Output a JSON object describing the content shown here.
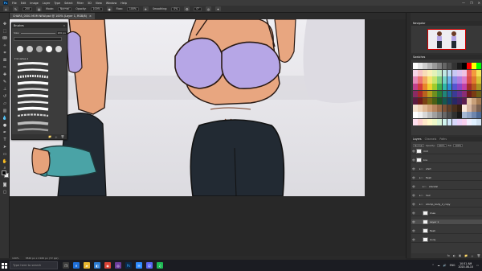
{
  "app": {
    "logo_label": "Ps",
    "menu": [
      "File",
      "Edit",
      "Image",
      "Layer",
      "Type",
      "Select",
      "Filter",
      "3D",
      "View",
      "Window",
      "Help"
    ],
    "window_controls": [
      "—",
      "❐",
      "✕"
    ]
  },
  "options_bar": {
    "size": "200",
    "mode_label": "Mode:",
    "mode_value": "Normal",
    "opacity_label": "Opacity:",
    "opacity_value": "100%",
    "flow_label": "Flow:",
    "flow_value": "100%",
    "smoothing_label": "Smoothing:",
    "smoothing_value": "0%",
    "angle_value": "0°"
  },
  "document_tab": {
    "title": "CHARS_0001 MOM NEW.psd @ 100% (Layer 1, RGB/8)",
    "close": "×"
  },
  "brushes_panel": {
    "title": "Brushes",
    "close": "«",
    "size_label": "Size:",
    "size_value": "200 px",
    "search_placeholder": "",
    "folder_name": "brushes 1"
  },
  "navigator_panel": {
    "tab": "Navigator"
  },
  "swatches_panel": {
    "tab": "Swatches",
    "colors": [
      "#ffffff",
      "#e8e8e8",
      "#cfcfcf",
      "#b5b5b5",
      "#9a9a9a",
      "#7f7f7f",
      "#666666",
      "#4d4d4d",
      "#333333",
      "#1a1a1a",
      "#000000",
      "#ff0000",
      "#ffff00",
      "#00ff00",
      "#f6d6e8",
      "#f7c3c3",
      "#f8dcb8",
      "#faf0b8",
      "#e3f2b8",
      "#c5ebc5",
      "#bfe8e3",
      "#bcdcf5",
      "#c8c8f3",
      "#dcc3f0",
      "#efc2e3",
      "#e55a5a",
      "#f39c3d",
      "#f2e35a",
      "#e38ab8",
      "#ea7070",
      "#f2a95e",
      "#f6e26e",
      "#c6e46a",
      "#7fd07f",
      "#6fd3c7",
      "#6ab4ea",
      "#8a8ae6",
      "#b07de0",
      "#dc7ac6",
      "#d94b4b",
      "#e07a2e",
      "#d6c236",
      "#c0418c",
      "#d33a3a",
      "#e8852b",
      "#efd02e",
      "#9fcb2c",
      "#3fb04f",
      "#2eb8a8",
      "#2b8ed6",
      "#5656d0",
      "#8a46c6",
      "#c040a4",
      "#a52a2a",
      "#b5591d",
      "#a89422",
      "#8a2a63",
      "#a82828",
      "#b8621e",
      "#b69c1f",
      "#6f8f1f",
      "#2a7f38",
      "#1f8679",
      "#1e659c",
      "#3b3b96",
      "#62318f",
      "#8a2d76",
      "#6e1c1c",
      "#7a3c13",
      "#6e5e16",
      "#5a1c41",
      "#6e1a1a",
      "#7a4114",
      "#786716",
      "#4a5f15",
      "#1c5425",
      "#145851",
      "#144368",
      "#282866",
      "#41215f",
      "#5c1e4f",
      "#e6c7a8",
      "#c9a07a",
      "#a57a52",
      "#f5e3d0",
      "#eed2b6",
      "#e0b894",
      "#cf9f78",
      "#b8865f",
      "#9c6b47",
      "#7e5236",
      "#624028",
      "#4a2f1d",
      "#352013",
      "#fbe9dc",
      "#d9b8a4",
      "#a88873",
      "#7a6050",
      "#ffffff",
      "#f0f0f0",
      "#d8d8d8",
      "#bcbcbc",
      "#a0a0a0",
      "#848484",
      "#686868",
      "#4c4c4c",
      "#303030",
      "#181818",
      "#a6b8d4",
      "#8fa3c4",
      "#6e86ad",
      "#4d6994",
      "#ffe0f0",
      "#ffd0d0",
      "#ffe8c8",
      "#fff8c8",
      "#eef8c8",
      "#d8f4d8",
      "#d0f4ef",
      "#cfe8fb",
      "#d8d8fb",
      "#ead0f8",
      "#f8d0ee",
      "#f0f0ff",
      "#e0f0ff",
      "#d0e0f0"
    ]
  },
  "layers_panel": {
    "tabs": [
      "Layers",
      "Channels",
      "Paths"
    ],
    "blend_mode": "Normal",
    "opacity_label": "Opacity:",
    "opacity_value": "100%",
    "fill_label": "Fill:",
    "fill_value": "100%",
    "layers": [
      {
        "name": "mid",
        "kind": "layer",
        "indent": 0,
        "selected": false
      },
      {
        "name": "bra",
        "kind": "layer",
        "indent": 0,
        "selected": false
      },
      {
        "name": "shirt",
        "kind": "group",
        "indent": 1,
        "selected": false
      },
      {
        "name": "flesh",
        "kind": "group",
        "indent": 1,
        "selected": false
      },
      {
        "name": "standal",
        "kind": "group",
        "indent": 2,
        "selected": false
      },
      {
        "name": "hair",
        "kind": "group",
        "indent": 1,
        "selected": false
      },
      {
        "name": "stomp_body_2_copy",
        "kind": "group",
        "indent": 1,
        "selected": false
      },
      {
        "name": "lines",
        "kind": "layer",
        "indent": 2,
        "selected": false
      },
      {
        "name": "Layer 1",
        "kind": "layer",
        "indent": 2,
        "selected": true
      },
      {
        "name": "flesh",
        "kind": "layer",
        "indent": 2,
        "selected": false
      },
      {
        "name": "body",
        "kind": "layer",
        "indent": 2,
        "selected": false
      }
    ],
    "footer_icons": [
      "fx",
      "◐",
      "▣",
      "📁",
      "＋",
      "🗑"
    ]
  },
  "status_bar": {
    "zoom": "100%",
    "doc_info": "3840 px x 2160 px (72 ppi)"
  },
  "taskbar": {
    "search_placeholder": "Type here to search",
    "time": "10:51 AM",
    "date": "2020-08-10",
    "tray_icons": [
      "^",
      "☁",
      "🔊",
      "ENG"
    ]
  }
}
